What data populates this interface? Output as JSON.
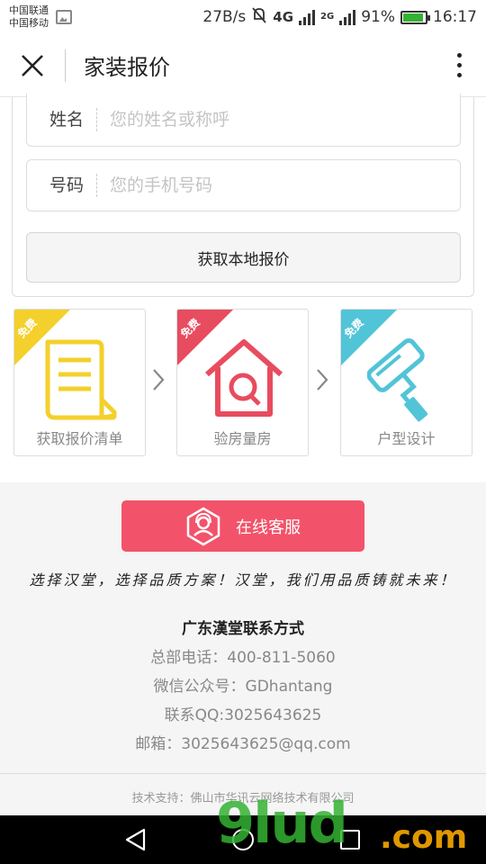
{
  "status_bar": {
    "carrier_1": "中国联通",
    "carrier_2": "中国移动",
    "net_speed": "27B/s",
    "net_4g": "4G",
    "net_2g": "2G",
    "battery": "91%",
    "time": "16:17"
  },
  "header": {
    "title": "家装报价",
    "close_icon": "close-icon",
    "more_icon": "more-vertical-icon"
  },
  "form": {
    "name_label": "姓名",
    "name_placeholder": "您的姓名或称呼",
    "phone_label": "号码",
    "phone_placeholder": "您的手机号码",
    "submit_label": "获取本地报价"
  },
  "steps": [
    {
      "badge": "免费",
      "label": "获取报价清单",
      "icon": "document-icon",
      "color": "#f3d02b"
    },
    {
      "badge": "免费",
      "label": "验房量房",
      "icon": "house-search-icon",
      "color": "#e84c5f"
    },
    {
      "badge": "免费",
      "label": "户型设计",
      "icon": "paint-roller-icon",
      "color": "#52c4d8"
    }
  ],
  "service": {
    "label": "在线客服",
    "icon": "customer-service-icon",
    "color": "#f2536a"
  },
  "slogan": "选择汉堂，选择品质方案！汉堂，我们用品质铸就未来！",
  "contact": {
    "title": "广东漢堂联系方式",
    "phone": "总部电话：400-811-5060",
    "wechat": "微信公众号：GDhantang",
    "qq": "联系QQ:3025643625",
    "email": "邮箱：3025643625@qq.com"
  },
  "support": "技术支持：佛山市华讯云网络技术有限公司",
  "watermark": {
    "brand": "9lud",
    "suffix": ".com"
  }
}
